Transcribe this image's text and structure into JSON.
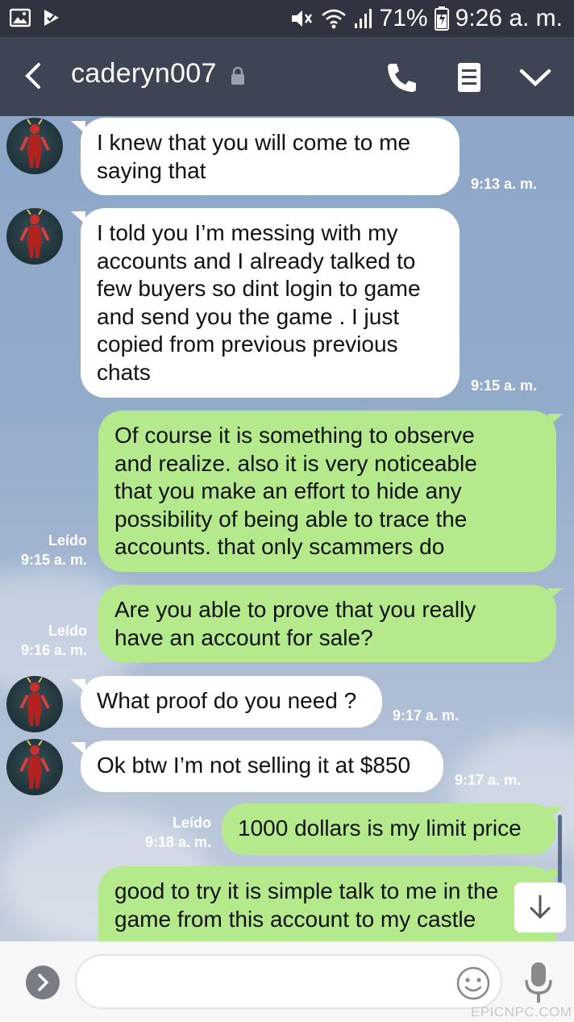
{
  "status_bar": {
    "battery": "71%",
    "time": "9:26 a. m."
  },
  "header": {
    "contact_name": "caderyn007"
  },
  "messages": [
    {
      "text": "I knew that you will come to me\nsaying that",
      "time": "9:13 a. m."
    },
    {
      "text": "I told you I’m messing with my\naccounts and I already talked to\nfew buyers so dint login to game\nand send you the game . I just\ncopied from previous previous\nchats",
      "time": "9:15 a. m."
    },
    {
      "text": "Of course it is something to observe\nand realize. also it is very noticeable\nthat you make an effort to hide any\npossibility of being able to trace the\naccounts. that only scammers do",
      "read": "Leído",
      "time": "9:15 a. m."
    },
    {
      "text": "Are you able to prove that you really\nhave an account for sale?",
      "read": "Leído",
      "time": "9:16 a. m."
    },
    {
      "text": "What proof do you need ?",
      "time": "9:17 a. m."
    },
    {
      "text": "Ok btw I’m not selling it at $850",
      "time": "9:17 a. m."
    },
    {
      "text": "1000 dollars is my limit price",
      "read": "Leído",
      "time": "9:18 a. m."
    },
    {
      "text": "good to try it is simple talk to me in the\ngame from this account to my castle"
    }
  ],
  "watermark": "EPICNPC.COM"
}
